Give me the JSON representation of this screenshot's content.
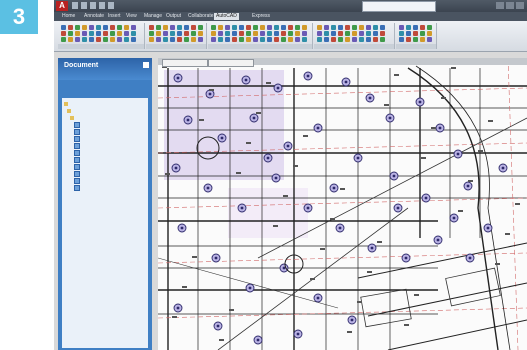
{
  "step": {
    "number": "3"
  },
  "titlebar": {
    "logo": "A",
    "title": "",
    "search_placeholder": ""
  },
  "ribbon": {
    "tabs": [
      {
        "label": "Home"
      },
      {
        "label": "Annotate"
      },
      {
        "label": "Insert"
      },
      {
        "label": "View"
      },
      {
        "label": "Manage"
      },
      {
        "label": "Output"
      },
      {
        "label": "Collaborate"
      },
      {
        "label": "AutoCAD"
      },
      {
        "label": "Express"
      }
    ],
    "panels": []
  },
  "palette": {
    "header": "Document",
    "tool_label": "",
    "tree": [
      {
        "label": "",
        "kind": "folder"
      },
      {
        "label": "",
        "kind": "folder"
      },
      {
        "label": "",
        "kind": "folder"
      },
      {
        "label": "",
        "kind": "file"
      },
      {
        "label": "",
        "kind": "file"
      },
      {
        "label": "",
        "kind": "file"
      },
      {
        "label": "",
        "kind": "file"
      },
      {
        "label": "",
        "kind": "file"
      },
      {
        "label": "",
        "kind": "file"
      },
      {
        "label": "",
        "kind": "file"
      },
      {
        "label": "",
        "kind": "file"
      },
      {
        "label": "",
        "kind": "file"
      },
      {
        "label": "",
        "kind": "file"
      }
    ]
  },
  "document_tabs": [
    {
      "label": ""
    },
    {
      "label": ""
    }
  ],
  "colors": {
    "step_badge": "#5bc0e3",
    "palette_blue": "#3f7fc4",
    "titlebar": "#3b4450",
    "ribbon": "#dfe3e8",
    "canvas": "#fbfbfb",
    "highlight": "#c8b6e6"
  }
}
